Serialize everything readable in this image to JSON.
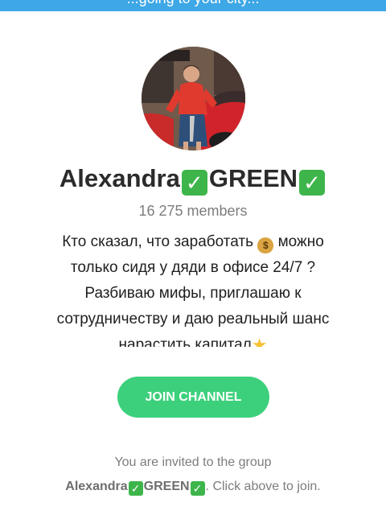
{
  "top_bar": {
    "text": "...going to your city..."
  },
  "channel": {
    "name_part1": "Alexandra",
    "name_part2": "GREEN",
    "check_icon": "white-heavy-check-mark",
    "members": "16 275 members",
    "description": {
      "line1_before": "Кто сказал, что заработать",
      "line1_emoji": "money-bag",
      "line1_after": "можно",
      "line2": "только сидя у дяди в офисе 24/7 ?",
      "line3": "Разбиваю мифы, приглашаю к",
      "line4": "сотрудничеству и даю реальный шанс",
      "line5": "нарастить капитал",
      "line5_emoji": "star"
    }
  },
  "join_button": {
    "label": "JOIN CHANNEL",
    "color": "#3dd07c"
  },
  "invite": {
    "line1": "You are invited to the group",
    "name_part1": "Alexandra",
    "name_part2": "GREEN",
    "suffix": ". Click above to join."
  },
  "colors": {
    "accent_top_bar": "#3ea7e6",
    "check_green": "#3db54a"
  }
}
